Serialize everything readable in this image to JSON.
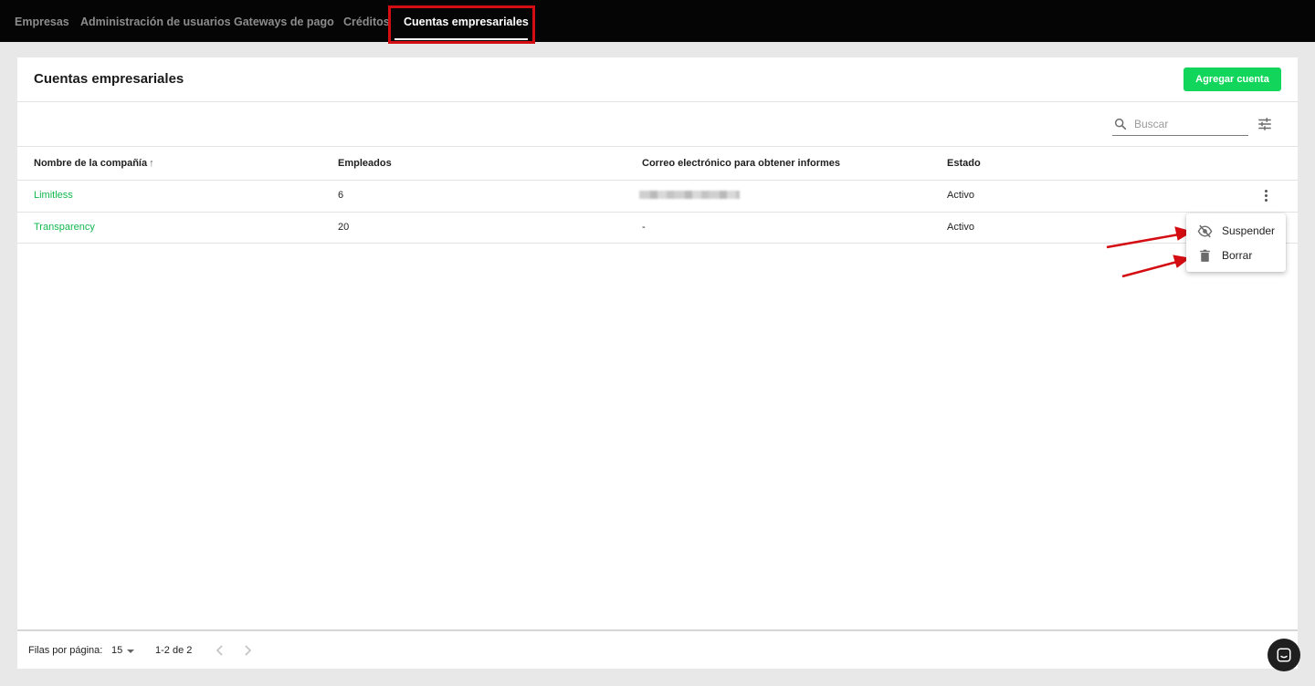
{
  "nav": {
    "tabs": [
      {
        "label": "Empresas"
      },
      {
        "label": "Administración de usuarios"
      },
      {
        "label": "Gateways de pago"
      },
      {
        "label": "Créditos"
      },
      {
        "label": "Cuentas empresariales"
      }
    ],
    "active_index": 4
  },
  "page": {
    "title": "Cuentas empresariales",
    "add_button": "Agregar cuenta"
  },
  "search": {
    "placeholder": "Buscar",
    "icon": "search-icon"
  },
  "filter": {
    "icon": "tune-icon"
  },
  "table": {
    "columns": [
      "Nombre de la compañía",
      "Empleados",
      "Correo electrónico para obtener informes",
      "Estado"
    ],
    "sort_indicator": "↑",
    "rows": [
      {
        "company": "Limitless",
        "employees": "6",
        "email": "",
        "status": "Activo"
      },
      {
        "company": "Transparency",
        "employees": "20",
        "email": "-",
        "status": "Activo"
      }
    ]
  },
  "row_menu": {
    "items": [
      {
        "label": "Suspender",
        "icon": "eye-off-icon"
      },
      {
        "label": "Borrar",
        "icon": "trash-icon"
      }
    ]
  },
  "pagination": {
    "rows_per_page_label": "Filas por página:",
    "rows_per_page": "15",
    "range": "1-2 de 2"
  },
  "colors": {
    "accent": "#12d65c",
    "link": "#12b84f",
    "nav_bg": "#050505",
    "annotation": "#d40d12"
  }
}
